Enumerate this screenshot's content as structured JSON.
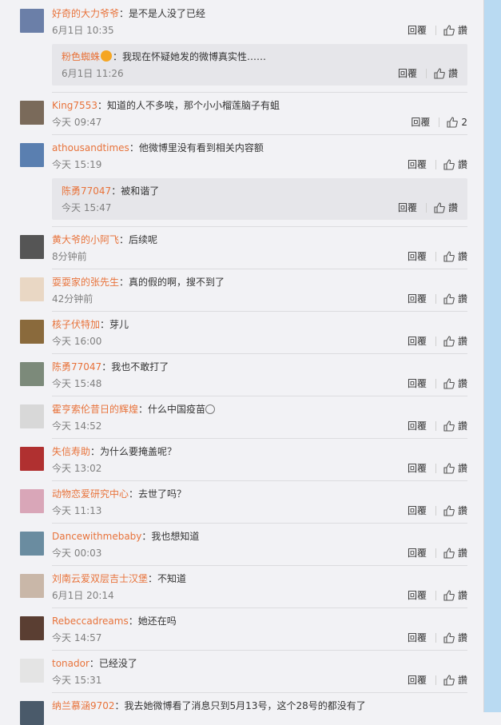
{
  "colors": {
    "username": "#e8733b",
    "timestamp": "#808080",
    "nested_bg": "#e6e6ea",
    "right_bar": "#b9daf2"
  },
  "comments": [
    {
      "user": "好奇的大力爷爷",
      "text": "：是不是人没了已经",
      "time": "6月1日 10:35",
      "reply": "回覆",
      "like": "讚",
      "avatar": "#6b7fa8",
      "nested": {
        "user": "粉色蜘蛛",
        "badge": true,
        "text": "：我现在怀疑她发的微博真实性……",
        "time": "6月1日 11:26",
        "reply": "回覆",
        "like": "讚"
      }
    },
    {
      "user": "King7553",
      "text": "：知道的人不多唉，那个小小榴莲脑子有蛆",
      "time": "今天 09:47",
      "reply": "回覆",
      "like": "2",
      "avatar": "#7a6a5a"
    },
    {
      "user": "athousandtimes",
      "text": "：他微博里没有看到相关内容额",
      "time": "今天 15:19",
      "reply": "回覆",
      "like": "讚",
      "avatar": "#5a7fb0",
      "nested": {
        "user": "陈勇77047",
        "text": "：被和谐了",
        "time": "今天 15:47",
        "reply": "回覆",
        "like": "讚"
      }
    },
    {
      "user": "黄大爷的小阿飞",
      "text": "：后续呢",
      "time": "8分钟前",
      "reply": "回覆",
      "like": "讚",
      "avatar": "#555555"
    },
    {
      "user": "耍耍家的张先生",
      "text": "：真的假的啊，搜不到了",
      "time": "42分钟前",
      "reply": "回覆",
      "like": "讚",
      "avatar": "#e9d7c4"
    },
    {
      "user": "核子伏特加",
      "text": "：芽儿",
      "time": "今天 16:00",
      "reply": "回覆",
      "like": "讚",
      "avatar": "#8a6a3c"
    },
    {
      "user": "陈勇77047",
      "text": "：我也不敢打了",
      "time": "今天 15:48",
      "reply": "回覆",
      "like": "讚",
      "avatar": "#7c8a7a"
    },
    {
      "user": "霍亨索伦昔日的辉煌",
      "text": "：什么中国疫苗",
      "emoji": true,
      "time": "今天 14:52",
      "reply": "回覆",
      "like": "讚",
      "avatar": "#d8d8d8"
    },
    {
      "user": "失信寿助",
      "text": "：为什么要掩盖呢？",
      "time": "今天 13:02",
      "reply": "回覆",
      "like": "讚",
      "avatar": "#b03030"
    },
    {
      "user": "动物恋爱研究中心",
      "text": "：去世了吗？",
      "time": "今天 11:13",
      "reply": "回覆",
      "like": "讚",
      "avatar": "#d9a6b8"
    },
    {
      "user": "Dancewithmebaby",
      "text": "：我也想知道",
      "time": "今天 00:03",
      "reply": "回覆",
      "like": "讚",
      "avatar": "#6a8ca0"
    },
    {
      "user": "刘南云爱双层吉士汉堡",
      "text": "：不知道",
      "time": "6月1日 20:14",
      "reply": "回覆",
      "like": "讚",
      "avatar": "#c9b7a8"
    },
    {
      "user": "Rebeccadreams",
      "text": "：她还在吗",
      "time": "今天 14:57",
      "reply": "回覆",
      "like": "讚",
      "avatar": "#5a3e32"
    },
    {
      "user": "tonador",
      "text": "：已经没了",
      "time": "今天 15:31",
      "reply": "回覆",
      "like": "讚",
      "avatar": "#e4e4e4"
    },
    {
      "user": "纳兰慕涵9702",
      "text": "：我去她微博看了消息只到5月13号，这个28号的都没有了",
      "time": "",
      "reply": "",
      "like": "",
      "avatar": "#4a5a6a"
    }
  ]
}
